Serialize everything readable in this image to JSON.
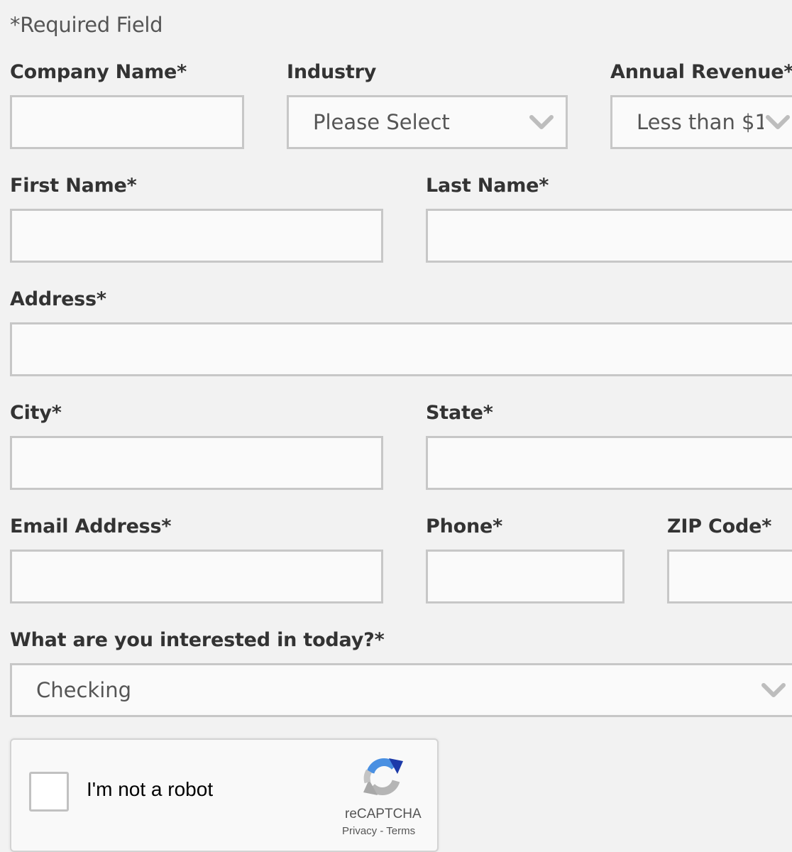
{
  "form": {
    "required_note": "*Required Field",
    "company_name": {
      "label": "Company Name*",
      "value": ""
    },
    "industry": {
      "label": "Industry",
      "selected": "Please Select"
    },
    "annual_revenue": {
      "label": "Annual Revenue*",
      "selected": "Less than $1"
    },
    "first_name": {
      "label": "First Name*",
      "value": ""
    },
    "last_name": {
      "label": "Last Name*",
      "value": ""
    },
    "address": {
      "label": "Address*",
      "value": ""
    },
    "city": {
      "label": "City*",
      "value": ""
    },
    "state": {
      "label": "State*",
      "value": ""
    },
    "email": {
      "label": "Email Address*",
      "value": ""
    },
    "phone": {
      "label": "Phone*",
      "value": ""
    },
    "zip": {
      "label": "ZIP Code*",
      "value": ""
    },
    "interest": {
      "label": "What are you interested in today?*",
      "selected": "Checking"
    }
  },
  "captcha": {
    "checkbox_label": "I'm not a robot",
    "brand": "reCAPTCHA",
    "links": "Privacy - Terms",
    "checked": false
  },
  "icons": {
    "select_chevron": "chevron-down-icon",
    "captcha_logo": "recaptcha-logo-icon"
  },
  "colors": {
    "page_background": "#f2f2f2",
    "field_border": "#c7c7c7",
    "field_background": "#fafafa",
    "label_text": "#333333",
    "chevron": "#bdbdbd"
  }
}
